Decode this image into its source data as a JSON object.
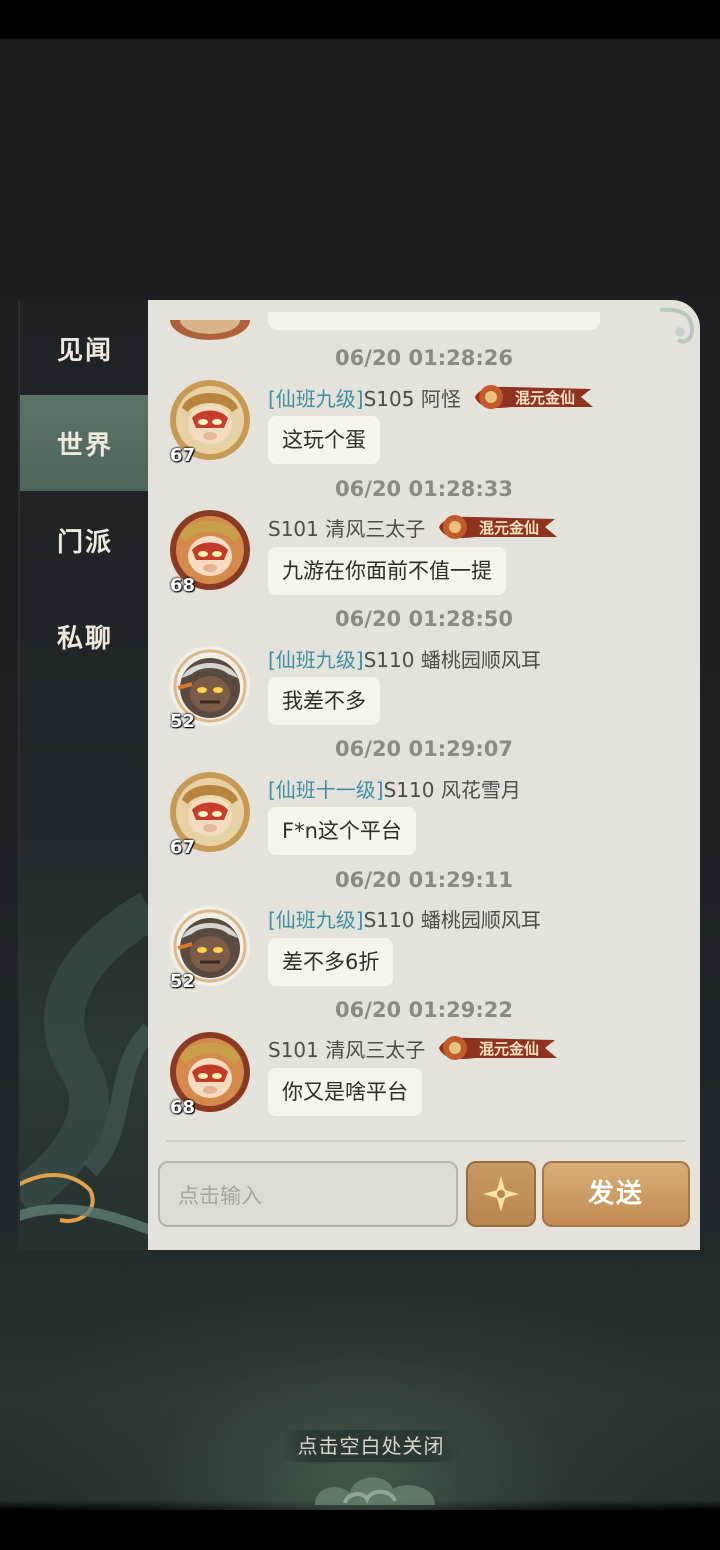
{
  "sidebar": {
    "tabs": [
      {
        "label": "见闻",
        "active": false
      },
      {
        "label": "世界",
        "active": true
      },
      {
        "label": "门派",
        "active": false
      },
      {
        "label": "私聊",
        "active": false
      }
    ]
  },
  "messages": [
    {
      "time": "06/20 01:28:26",
      "rank": "[仙班九级]",
      "name": "S105 阿怪",
      "has_title_badge": true,
      "title_badge": "混元金仙",
      "level": "67",
      "avatar": "monkey-king-avatar",
      "text": "这玩个蛋"
    },
    {
      "time": "06/20 01:28:33",
      "rank": "",
      "name": "S101 清风三太子",
      "has_title_badge": true,
      "title_badge": "混元金仙",
      "level": "68",
      "avatar": "monkey-king-avatar",
      "text": "九游在你面前不值一提"
    },
    {
      "time": "06/20 01:28:50",
      "rank": "[仙班九级]",
      "name": "S110 蟠桃园顺风耳",
      "has_title_badge": false,
      "level": "52",
      "avatar": "demon-avatar",
      "text": "我差不多"
    },
    {
      "time": "06/20 01:29:07",
      "rank": "[仙班十一级]",
      "name": "S110 风花雪月",
      "has_title_badge": false,
      "level": "67",
      "avatar": "monkey-king-avatar",
      "text": "F*n这个平台"
    },
    {
      "time": "06/20 01:29:11",
      "rank": "[仙班九级]",
      "name": "S110 蟠桃园顺风耳",
      "has_title_badge": false,
      "level": "52",
      "avatar": "demon-avatar",
      "text": "差不多6折"
    },
    {
      "time": "06/20 01:29:22",
      "rank": "",
      "name": "S101 清风三太子",
      "has_title_badge": true,
      "title_badge": "混元金仙",
      "level": "68",
      "avatar": "monkey-king-avatar",
      "text": "你又是啥平台"
    }
  ],
  "input": {
    "placeholder": "点击输入"
  },
  "buttons": {
    "emoji_icon": "sparkle-icon",
    "send_label": "发送"
  },
  "close_hint": "点击空白处关闭",
  "colors": {
    "accent_tab": "#56705f",
    "send_button": "#c99a63",
    "rank_text": "#3f8ea3"
  }
}
